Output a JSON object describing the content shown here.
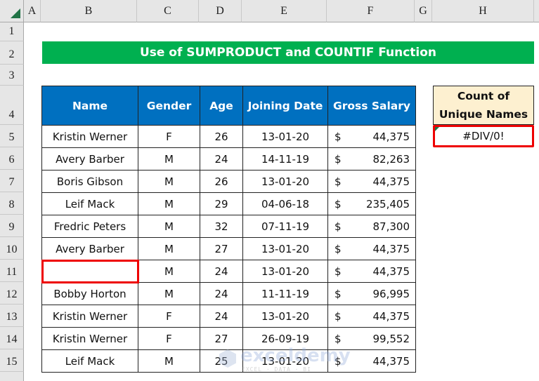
{
  "columns": [
    "A",
    "B",
    "C",
    "D",
    "E",
    "F",
    "G",
    "H"
  ],
  "rows": [
    "1",
    "2",
    "3",
    "4",
    "5",
    "6",
    "7",
    "8",
    "9",
    "10",
    "11",
    "12",
    "13",
    "14",
    "15"
  ],
  "title": "Use of SUMPRODUCT and COUNTIF Function",
  "table": {
    "headers": [
      "Name",
      "Gender",
      "Age",
      "Joining Date",
      "Gross Salary"
    ],
    "currency_symbol": "$",
    "rows": [
      {
        "name": "Kristin Werner",
        "gender": "F",
        "age": "26",
        "date": "13-01-20",
        "salary": "44,375"
      },
      {
        "name": "Avery Barber",
        "gender": "M",
        "age": "24",
        "date": "14-11-19",
        "salary": "82,263"
      },
      {
        "name": "Boris Gibson",
        "gender": "M",
        "age": "26",
        "date": "13-01-20",
        "salary": "44,375"
      },
      {
        "name": "Leif Mack",
        "gender": "M",
        "age": "29",
        "date": "04-06-18",
        "salary": "235,405"
      },
      {
        "name": "Fredric Peters",
        "gender": "M",
        "age": "32",
        "date": "07-11-19",
        "salary": "87,300"
      },
      {
        "name": "Avery Barber",
        "gender": "M",
        "age": "27",
        "date": "13-01-20",
        "salary": "44,375"
      },
      {
        "name": "",
        "gender": "M",
        "age": "24",
        "date": "13-01-20",
        "salary": "44,375"
      },
      {
        "name": "Bobby Horton",
        "gender": "M",
        "age": "24",
        "date": "11-11-19",
        "salary": "96,995"
      },
      {
        "name": "Kristin Werner",
        "gender": "F",
        "age": "24",
        "date": "13-01-20",
        "salary": "44,375"
      },
      {
        "name": "Kristin Werner",
        "gender": "F",
        "age": "27",
        "date": "26-09-19",
        "salary": "99,552"
      },
      {
        "name": "Leif Mack",
        "gender": "M",
        "age": "25",
        "date": "13-01-20",
        "salary": "44,375"
      }
    ]
  },
  "unique": {
    "header_line1": "Count of",
    "header_line2": "Unique Names",
    "value": "#DIV/0!"
  },
  "watermark": {
    "text": "exceldemy",
    "sub": "EXCEL · DATA · BI"
  },
  "colors": {
    "title_bg": "#00b050",
    "header_bg": "#0070c0",
    "unique_header_bg": "#fdf0d0",
    "highlight": "#ee0000"
  }
}
